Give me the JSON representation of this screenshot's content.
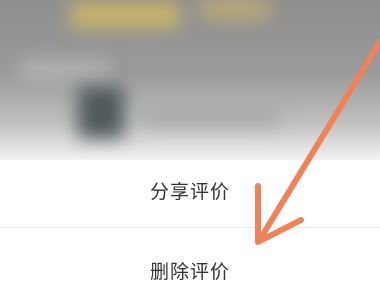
{
  "action_sheet": {
    "share_label": "分享评价",
    "delete_label": "删除评价"
  },
  "annotation": {
    "arrow_color": "#f0825a",
    "points_to": "delete"
  }
}
